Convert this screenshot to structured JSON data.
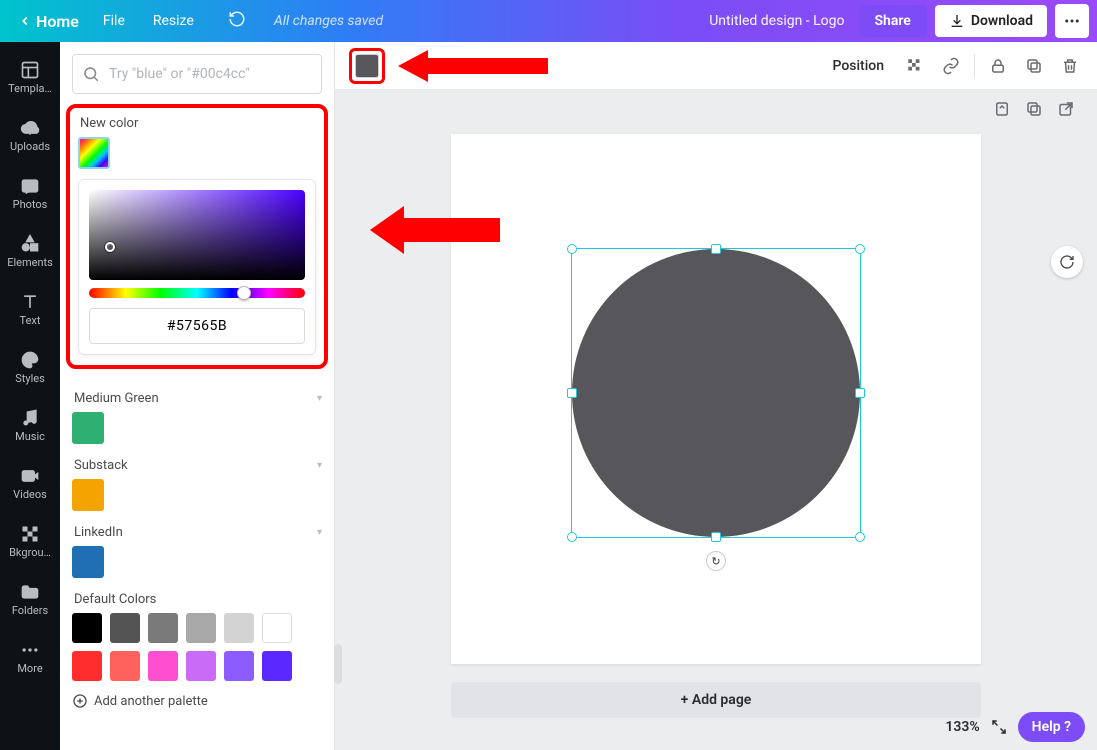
{
  "topbar": {
    "home": "Home",
    "file": "File",
    "resize": "Resize",
    "saved": "All changes saved",
    "doc_title": "Untitled design - Logo",
    "share": "Share",
    "download": "Download"
  },
  "rail": {
    "templates": "Templa…",
    "uploads": "Uploads",
    "photos": "Photos",
    "elements": "Elements",
    "text": "Text",
    "styles": "Styles",
    "music": "Music",
    "videos": "Videos",
    "bkground": "Bkgrou…",
    "folders": "Folders",
    "more": "More"
  },
  "panel": {
    "search_placeholder": "Try \"blue\" or \"#00c4cc\"",
    "new_color": "New color",
    "hex_value": "#57565B",
    "palettes": {
      "medium_green": {
        "label": "Medium Green",
        "color": "#2faf72"
      },
      "substack": {
        "label": "Substack",
        "color": "#f5a300"
      },
      "linkedin": {
        "label": "LinkedIn",
        "color": "#1f6fb2"
      }
    },
    "default_label": "Default Colors",
    "default_colors": [
      "#000000",
      "#545454",
      "#7a7a7a",
      "#a8a8a8",
      "#d3d3d3",
      "#ffffff",
      "#ff2d2d",
      "#ff615d",
      "#ff4fd1",
      "#c96bf6",
      "#8d5cff",
      "#5b28ff"
    ],
    "add_palette": "Add another palette"
  },
  "context": {
    "position": "Position",
    "fill_color": "#57565B"
  },
  "canvas": {
    "add_page": "+ Add page",
    "zoom": "133%"
  },
  "help": "Help ?"
}
